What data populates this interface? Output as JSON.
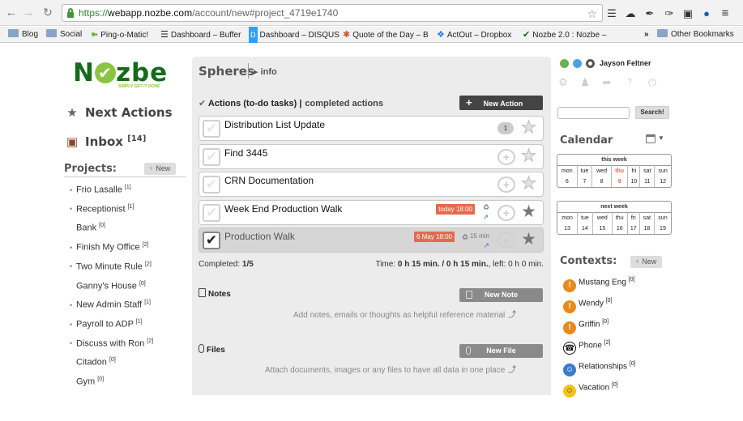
{
  "browser": {
    "url_scheme": "https://",
    "url_host": "webapp.nozbe.com",
    "url_path": "/account/new#project_4719e1740",
    "bookmarks": [
      {
        "label": "Blog",
        "icon": "folder-icon"
      },
      {
        "label": "Social",
        "icon": "folder-icon"
      },
      {
        "label": "Ping-o-Matic!",
        "icon": "ping-icon"
      },
      {
        "label": "Dashboard – Buffer",
        "icon": "buffer-icon"
      },
      {
        "label": "Dashboard – DISQUS",
        "icon": "disqus-icon"
      },
      {
        "label": "Quote of the Day – B",
        "icon": "pinwheel-icon"
      },
      {
        "label": "ActOut – Dropbox",
        "icon": "dropbox-icon"
      },
      {
        "label": "Nozbe 2.0 : Nozbe –",
        "icon": "nozbe-icon"
      }
    ],
    "overflow": "»",
    "other_bookmarks": "Other Bookmarks"
  },
  "sidebar": {
    "logo_text": "Nozbe",
    "logo_tagline": "SIMPLY GET IT DONE",
    "next_actions": "Next Actions",
    "inbox_label": "Inbox",
    "inbox_count": "[14]",
    "projects_title": "Projects:",
    "new_label": "New",
    "projects": [
      {
        "name": "Frio Lasalle",
        "count": "[1]",
        "bullet": true
      },
      {
        "name": "Receptionist",
        "count": "[1]",
        "bullet": true
      },
      {
        "name": "Bank",
        "count": "[0]",
        "bullet": false
      },
      {
        "name": "Finish My Office",
        "count": "[2]",
        "bullet": true
      },
      {
        "name": "Two Minute Rule",
        "count": "[2]",
        "bullet": true
      },
      {
        "name": "Ganny's House",
        "count": "[0]",
        "bullet": false
      },
      {
        "name": "New Admin Staff",
        "count": "[1]",
        "bullet": true
      },
      {
        "name": "Payroll to ADP",
        "count": "[1]",
        "bullet": true
      },
      {
        "name": "Discuss with Ron",
        "count": "[2]",
        "bullet": true
      },
      {
        "name": "Citadon",
        "count": "[0]",
        "bullet": false
      },
      {
        "name": "Gym",
        "count": "[0]",
        "bullet": false
      }
    ]
  },
  "main": {
    "title": "Spheres",
    "info": "info",
    "actions_header": "Actions (to-do tasks)",
    "separator": "|",
    "completed_actions": "completed actions",
    "new_action": "New Action",
    "tasks": [
      {
        "name": "Distribution List Update",
        "comments": "1",
        "due": "",
        "duration": "",
        "done": false,
        "starred": false
      },
      {
        "name": "Find 3445",
        "comments": "",
        "due": "",
        "duration": "",
        "done": false,
        "starred": false
      },
      {
        "name": "CRN Documentation",
        "comments": "",
        "due": "",
        "duration": "",
        "done": false,
        "starred": false
      },
      {
        "name": "Week End Production Walk",
        "comments": "",
        "due": "today 18:00",
        "duration": "",
        "done": false,
        "starred": true
      },
      {
        "name": "Production Walk",
        "comments": "",
        "due": "6 May 18:00",
        "duration": "15 min",
        "done": true,
        "starred": true
      }
    ],
    "completed_label": "Completed:",
    "completed_value": "1/5",
    "time_label": "Time:",
    "time_value": "0 h 15 min. / 0 h 15 min.",
    "left_label": ", left:",
    "left_value": "0 h 0 min.",
    "notes_title": "Notes",
    "new_note": "New Note",
    "notes_hint": "Add notes, emails or thoughts as helpful reference material",
    "files_title": "Files",
    "new_file": "New File",
    "files_hint": "Attach documents, images or any files to have all data in one place"
  },
  "right": {
    "user_name": "Jayson Feltner",
    "search_button": "Search!",
    "calendar_title": "Calendar",
    "this_week": {
      "title": "this week",
      "days": [
        "mon",
        "tue",
        "wed",
        "thu",
        "fri",
        "sat",
        "sun"
      ],
      "dates": [
        "6",
        "7",
        "8",
        "9",
        "10",
        "11",
        "12"
      ],
      "today_index": 3
    },
    "next_week": {
      "title": "next week",
      "days": [
        "mon",
        "tue",
        "wed",
        "thu",
        "fri",
        "sat",
        "sun"
      ],
      "dates": [
        "13",
        "14",
        "15",
        "16",
        "17",
        "18",
        "19"
      ]
    },
    "contexts_title": "Contexts:",
    "new_label": "New",
    "contexts": [
      {
        "name": "Mustang Eng",
        "count": "[0]",
        "icon": "alert-icon",
        "color": "#e98a17"
      },
      {
        "name": "Wendy",
        "count": "[0]",
        "icon": "alert-icon",
        "color": "#e98a17"
      },
      {
        "name": "Griffin",
        "count": "[0]",
        "icon": "alert-icon",
        "color": "#e98a17"
      },
      {
        "name": "Phone",
        "count": "[2]",
        "icon": "phone-icon",
        "color": "#ffffff"
      },
      {
        "name": "Relationships",
        "count": "[0]",
        "icon": "people-icon",
        "color": "#3a7cc9"
      },
      {
        "name": "Vacation",
        "count": "[0]",
        "icon": "smiley-icon",
        "color": "#f3c419"
      }
    ]
  },
  "colors": {
    "brand_green": "#156b1a",
    "accent_green": "#8bc53f",
    "due_red": "#e7694d",
    "today_red": "#e7694d"
  }
}
